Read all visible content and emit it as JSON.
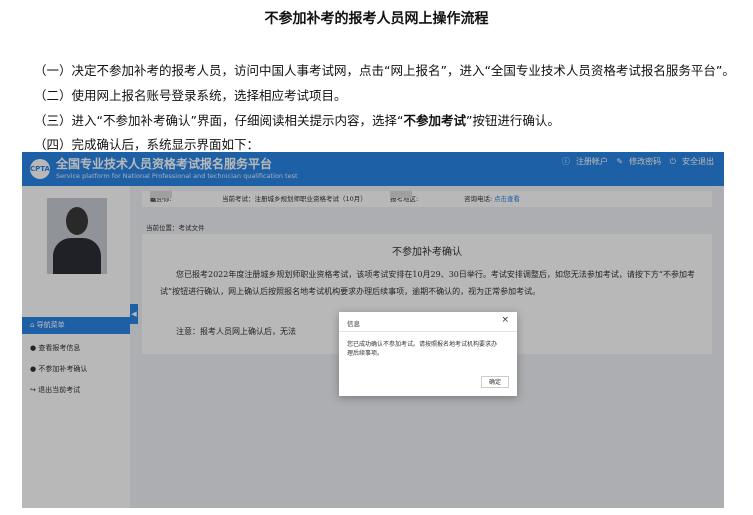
{
  "doc": {
    "title": "不参加补考的报考人员网上操作流程",
    "step1": "（一）决定不参加补考的报考人员，访问中国人事考试网，点击“网上报名”，进入“全国专业技术人员资格考试报名服务平台”。",
    "step2": "（二）使用网上报名账号登录系统，选择相应考试项目。",
    "step3_pre": "（三）进入“不参加补考确认”界面，仔细阅读相关提示内容，选择“",
    "step3_bold": "不参加考试",
    "step3_post": "”按钮进行确认。",
    "step4": "（四）完成确认后，系统显示界面如下："
  },
  "screenshot": {
    "header": {
      "title": "全国专业技术人员资格考试报名服务平台",
      "subtitle": "Service platform for National Professional and technician qualification test",
      "links": [
        "注册帐户",
        "修改密码",
        "安全退出"
      ]
    },
    "sidebar": {
      "nav_header": "导航菜单",
      "items": [
        "查看报考信息",
        "不参加补考确认",
        "退出当前考试"
      ]
    },
    "info_bar": {
      "welcome": "欢迎你:",
      "exam": "当前考试：注册城乡规划师职业资格考试（10月）",
      "region": "报考地区:",
      "phone": "咨询电话:",
      "link": "点击查看"
    },
    "breadcrumb": "当前位置：考试文件",
    "card": {
      "title": "不参加补考确认",
      "notice": "您已报考2022年度注册城乡规划师职业资格考试，该项考试安排在10月29、30日举行。考试安排调整后，如您无法参加考试，请按下方“不参加考试”按钮进行确认，网上确认后按照报名地考试机构要求办理后续事项，逾期不确认的，视为正常参加考试。",
      "note": "注意：报考人员网上确认后，无法"
    },
    "modal": {
      "title": "信息",
      "close": "×",
      "message": "您已成功确认不参加考试。请按照报名地考试机构要求办理后续事项。",
      "ok": "确定"
    }
  },
  "colors": {
    "brand": "#2a86e6"
  }
}
